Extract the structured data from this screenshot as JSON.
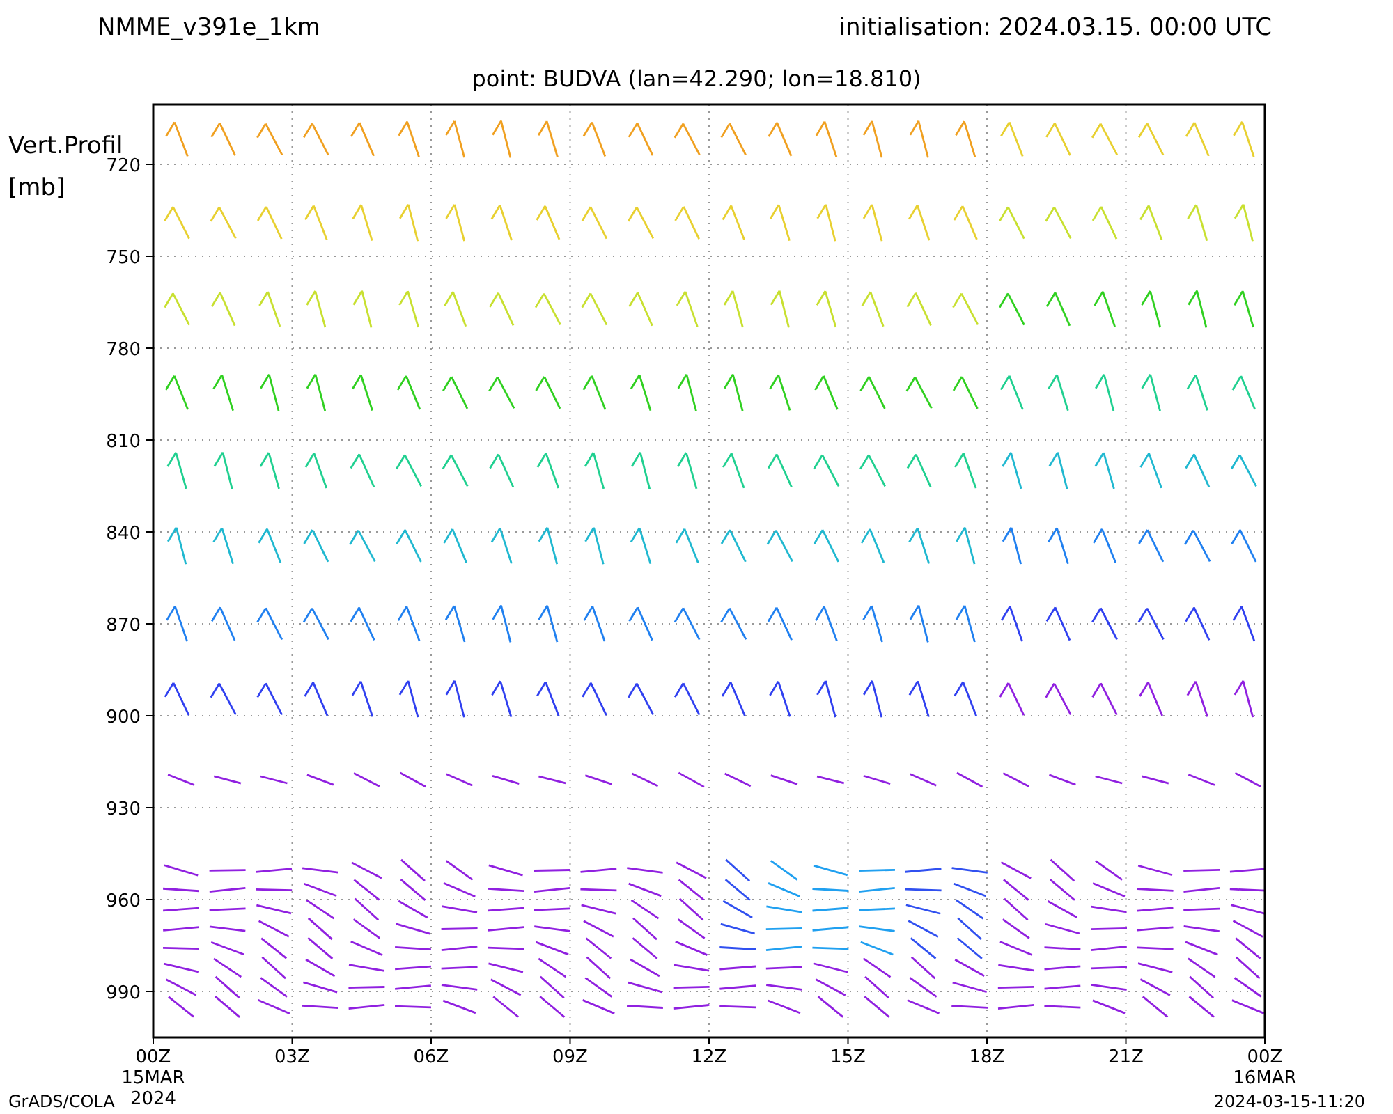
{
  "header": {
    "model": "NMME_v391e_1km",
    "initialisation": "initialisation: 2024.03.15. 00:00 UTC",
    "point": "point: BUDVA (lan=42.290; lon=18.810)"
  },
  "plot": {
    "y_label": [
      "Vert.Profil",
      "[mb]"
    ],
    "y_ticks": [
      "720",
      "750",
      "780",
      "810",
      "840",
      "870",
      "900",
      "930",
      "960",
      "990"
    ],
    "x_ticks": [
      {
        "label": "00Z",
        "lines": [
          "15MAR",
          "2024"
        ]
      },
      {
        "label": "03Z"
      },
      {
        "label": "06Z"
      },
      {
        "label": "09Z"
      },
      {
        "label": "12Z"
      },
      {
        "label": "15Z"
      },
      {
        "label": "18Z"
      },
      {
        "label": "21Z"
      },
      {
        "label": "00Z",
        "lines": [
          "16MAR"
        ]
      }
    ]
  },
  "footer": {
    "left": "GrADS/COLA",
    "right": "2024-03-15-11:20"
  }
}
